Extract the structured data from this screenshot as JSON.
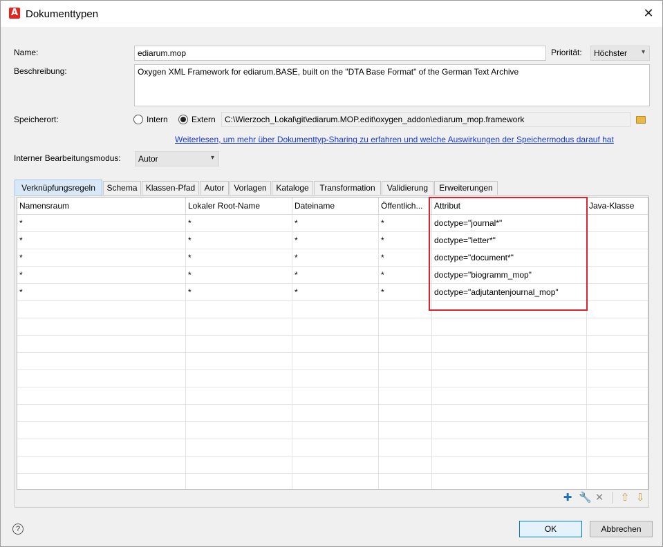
{
  "window": {
    "title": "Dokumenttypen"
  },
  "form": {
    "name_label": "Name:",
    "name_value": "ediarum.mop",
    "priority_label": "Priorität:",
    "priority_value": "Höchster",
    "description_label": "Beschreibung:",
    "description_value": "Oxygen XML Framework for ediarum.BASE, built on the \"DTA Base Format\" of the German Text Archive",
    "storage_label": "Speicherort:",
    "storage_intern": "Intern",
    "storage_extern": "Extern",
    "storage_selected": "Extern",
    "storage_path": "C:\\Wierzoch_Lokal\\git\\ediarum.MOP.edit\\oxygen_addon\\ediarum_mop.framework",
    "sharing_link": "Weiterlesen, um mehr über Dokumenttyp-Sharing zu erfahren und welche Auswirkungen der Speichermodus darauf hat",
    "edit_mode_label": "Interner Bearbeitungsmodus:",
    "edit_mode_value": "Autor"
  },
  "tabs": [
    {
      "label": "Verknüpfungsregeln",
      "active": true
    },
    {
      "label": "Schema"
    },
    {
      "label": "Klassen-Pfad"
    },
    {
      "label": "Autor"
    },
    {
      "label": "Vorlagen"
    },
    {
      "label": "Kataloge"
    },
    {
      "label": "Transformation"
    },
    {
      "label": "Validierung"
    },
    {
      "label": "Erweiterungen"
    }
  ],
  "table": {
    "columns": [
      "Namensraum",
      "Lokaler Root-Name",
      "Dateiname",
      "Öffentlich...",
      "Attribut",
      "Java-Klasse"
    ],
    "rows": [
      [
        "*",
        "*",
        "*",
        "*",
        "doctype=\"journal*\"",
        ""
      ],
      [
        "*",
        "*",
        "*",
        "*",
        "doctype=\"letter*\"",
        ""
      ],
      [
        "*",
        "*",
        "*",
        "*",
        "doctype=\"document*\"",
        ""
      ],
      [
        "*",
        "*",
        "*",
        "*",
        "doctype=\"biogramm_mop\"",
        ""
      ],
      [
        "*",
        "*",
        "*",
        "*",
        "doctype=\"adjutantenjournal_mop\"",
        ""
      ]
    ],
    "empty_rows": 11
  },
  "toolbar": {
    "icons": [
      "add-icon",
      "edit-icon",
      "delete-icon",
      "move-up-icon",
      "move-down-icon"
    ]
  },
  "buttons": {
    "ok": "OK",
    "cancel": "Abbrechen"
  },
  "colors": {
    "highlight": "#e0202a",
    "link": "#1a3cd8",
    "active_tab": "#d9e8f7"
  }
}
